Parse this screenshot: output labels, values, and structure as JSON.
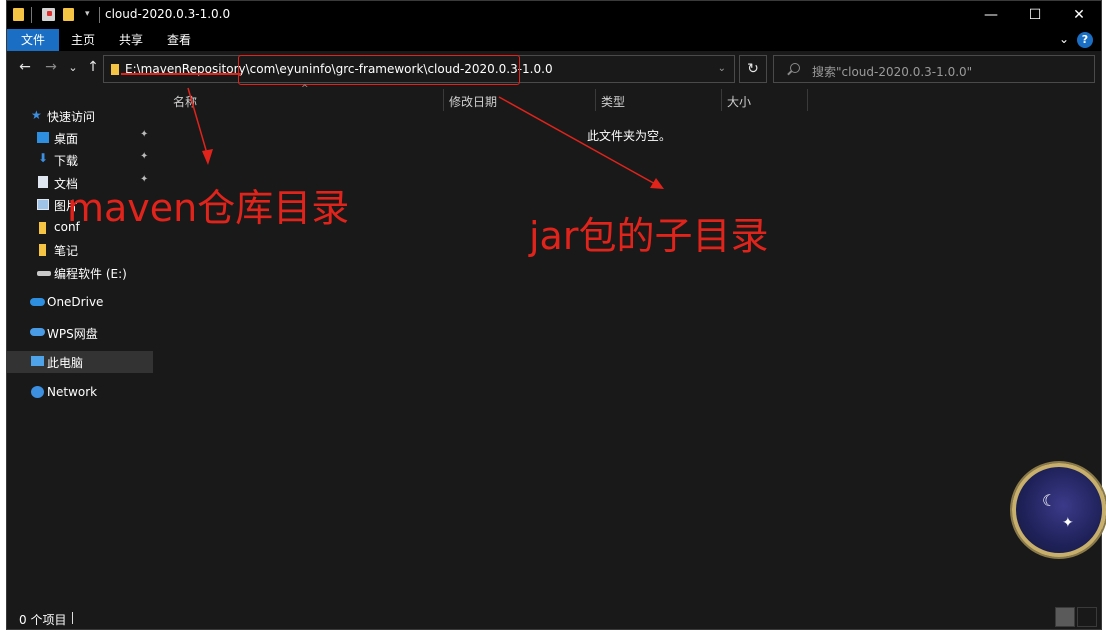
{
  "window": {
    "title": "cloud-2020.0.3-1.0.0",
    "controls": {
      "minimize": "—",
      "maximize": "☐",
      "close": "✕"
    }
  },
  "ribbon": {
    "tabs": [
      {
        "label": "文件",
        "active": true
      },
      {
        "label": "主页",
        "active": false
      },
      {
        "label": "共享",
        "active": false
      },
      {
        "label": "查看",
        "active": false
      }
    ],
    "expand_glyph": "⌄",
    "help_glyph": "?"
  },
  "navigation": {
    "back": "←",
    "forward": "→",
    "recent": "⌄",
    "up": "↑",
    "path_prefix": "E:\\mavenRepository\\",
    "path_suffix": "com\\eyuninfo\\grc-framework\\cloud-2020.0.3-1.0.0",
    "dropdown": "⌄",
    "refresh": "↻",
    "search_placeholder": "搜索\"cloud-2020.0.3-1.0.0\""
  },
  "sidebar": {
    "items": [
      {
        "label": "快速访问",
        "icon": "star-icon"
      },
      {
        "label": "桌面",
        "icon": "desktop-icon",
        "pinned": true
      },
      {
        "label": "下载",
        "icon": "download-icon",
        "pinned": true
      },
      {
        "label": "文档",
        "icon": "document-icon",
        "pinned": true
      },
      {
        "label": "图片",
        "icon": "picture-icon",
        "pinned": true
      },
      {
        "label": "conf",
        "icon": "folder-icon"
      },
      {
        "label": "笔记",
        "icon": "folder-icon"
      },
      {
        "label": "编程软件 (E:)",
        "icon": "drive-icon"
      },
      {
        "label": "OneDrive",
        "icon": "cloud-icon"
      },
      {
        "label": "WPS网盘",
        "icon": "cloud-icon"
      },
      {
        "label": "此电脑",
        "icon": "computer-icon",
        "selected": true
      },
      {
        "label": "Network",
        "icon": "network-icon"
      }
    ],
    "pin_glyph": "📌"
  },
  "content": {
    "columns": [
      "名称",
      "修改日期",
      "类型",
      "大小"
    ],
    "sort_caret": "^",
    "empty_message": "此文件夹为空。"
  },
  "status": {
    "item_count": "0 个项目"
  },
  "annotations": {
    "left": "maven仓库目录",
    "right": "jar包的子目录"
  },
  "colors": {
    "accent": "#1a6fc4",
    "annotation": "#e0231b",
    "background": "#191919",
    "folder": "#f6c445"
  }
}
